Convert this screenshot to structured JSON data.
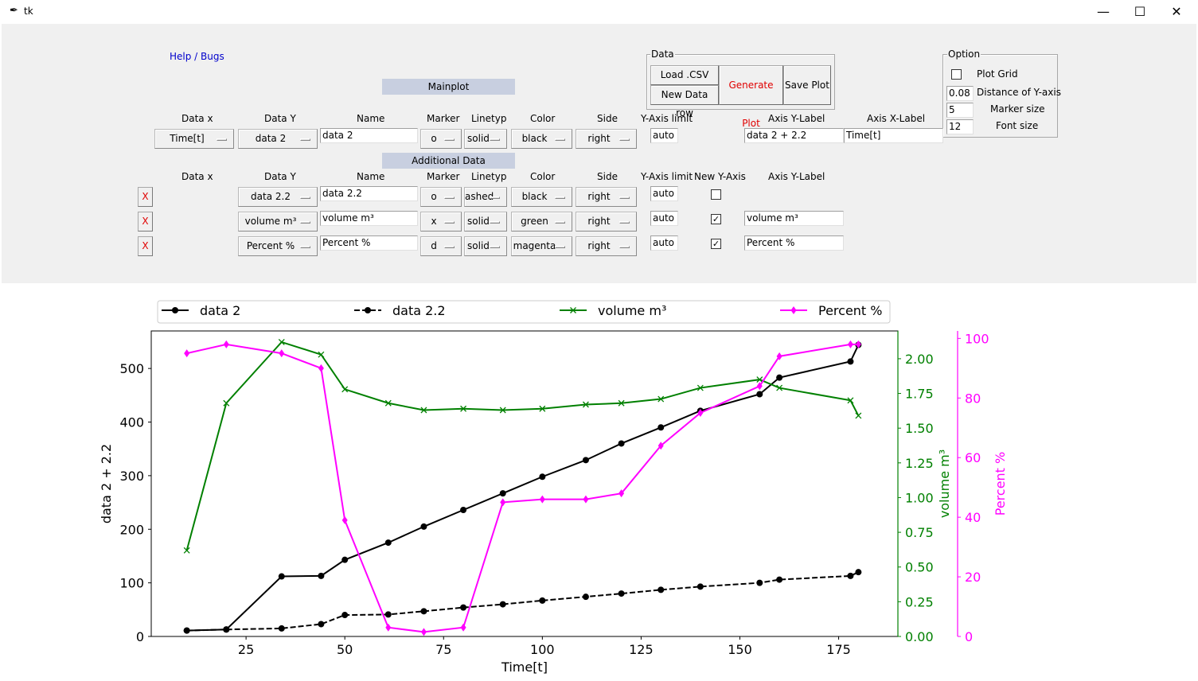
{
  "window": {
    "title": "tk",
    "minimize": "—",
    "maximize": "☐",
    "close": "✕"
  },
  "help_link": "Help / Bugs",
  "sections": {
    "main": "Mainplot",
    "additional": "Additional Data"
  },
  "data_frame": {
    "label": "Data",
    "load": "Load .CSV File",
    "new_row": "New Data row",
    "generate": "Generate Plot",
    "save": "Save Plot"
  },
  "option_frame": {
    "label": "Option",
    "plot_grid": "Plot Grid",
    "plot_grid_checked": false,
    "dist_label": "Distance of Y-axis",
    "dist_value": "0.08",
    "marker_label": "Marker size",
    "marker_value": "5",
    "font_label": "Font size",
    "font_value": "12"
  },
  "headers": {
    "data_x": "Data x",
    "data_y": "Data Y",
    "name": "Name",
    "marker": "Marker",
    "linetyp": "Linetyp",
    "color": "Color",
    "side": "Side",
    "ylimit": "Y-Axis limit",
    "new_yaxis": "New Y-Axis",
    "ylabel": "Axis Y-Label",
    "xlabel": "Axis X-Label"
  },
  "main_row": {
    "data_x": "Time[t]",
    "data_y": "data 2",
    "name": "data 2",
    "marker": "o",
    "linetyp": "solid",
    "color": "black",
    "side": "right",
    "ylimit": "auto",
    "ylabel": "data 2 + 2.2",
    "xlabel": "Time[t]"
  },
  "extra_rows": [
    {
      "x": "X",
      "data_y": "data 2.2",
      "name": "data 2.2",
      "marker": "o",
      "linetyp": "ashed",
      "color": "black",
      "side": "right",
      "ylimit": "auto",
      "new_axis": false,
      "ylabel": ""
    },
    {
      "x": "X",
      "data_y": "volume m³",
      "name": "volume m³",
      "marker": "x",
      "linetyp": "solid",
      "color": "green",
      "side": "right",
      "ylimit": "auto",
      "new_axis": true,
      "ylabel": "volume m³"
    },
    {
      "x": "X",
      "data_y": "Percent %",
      "name": "Percent %",
      "marker": "d",
      "linetyp": "solid",
      "color": "magenta",
      "side": "right",
      "ylimit": "auto",
      "new_axis": true,
      "ylabel": "Percent %"
    }
  ],
  "chart_data": {
    "type": "line",
    "xlabel": "Time[t]",
    "x": [
      10,
      20,
      34,
      44,
      50,
      61,
      70,
      80,
      90,
      100,
      111,
      120,
      130,
      140,
      155,
      160,
      178,
      180
    ],
    "xlim": [
      1,
      190
    ],
    "xticks": [
      25,
      50,
      75,
      100,
      125,
      150,
      175
    ],
    "legend": "top",
    "grid": false,
    "series": [
      {
        "name": "data 2",
        "axis": "left",
        "color": "#000000",
        "marker": "o",
        "dash": "solid",
        "values": [
          11,
          13,
          112,
          113,
          143,
          175,
          205,
          236,
          267,
          298,
          329,
          360,
          390,
          421,
          452,
          483,
          513,
          544
        ]
      },
      {
        "name": "data 2.2",
        "axis": "left",
        "color": "#000000",
        "marker": "o",
        "dash": "dashed",
        "values": [
          11,
          13,
          15,
          23,
          40,
          41,
          47,
          54,
          60,
          67,
          74,
          80,
          87,
          93,
          100,
          106,
          113,
          120
        ]
      },
      {
        "name": "volume m³",
        "axis": "volume",
        "color": "#008000",
        "marker": "x",
        "dash": "solid",
        "values": [
          0.62,
          1.68,
          2.12,
          2.03,
          1.78,
          1.68,
          1.63,
          1.64,
          1.63,
          1.64,
          1.67,
          1.68,
          1.71,
          1.79,
          1.85,
          1.79,
          1.7,
          1.59
        ]
      },
      {
        "name": "Percent %",
        "axis": "percent",
        "color": "#ff00ff",
        "marker": "d",
        "dash": "solid",
        "values": [
          95,
          98,
          95,
          90,
          39,
          3,
          1.5,
          3,
          45,
          46,
          46,
          48,
          64,
          75,
          84,
          94,
          98,
          98
        ]
      }
    ],
    "axes": {
      "left": {
        "label": "data 2 + 2.2",
        "ylim": [
          0,
          570
        ],
        "ticks": [
          0,
          100,
          200,
          300,
          400,
          500
        ],
        "color": "#000000"
      },
      "volume": {
        "label": "volume m³",
        "ylim": [
          0,
          2.2
        ],
        "ticks": [
          0.0,
          0.25,
          0.5,
          0.75,
          1.0,
          1.25,
          1.5,
          1.75,
          2.0
        ],
        "color": "#008000"
      },
      "percent": {
        "label": "Percent %",
        "ylim": [
          0,
          102.5
        ],
        "ticks": [
          0,
          20,
          40,
          60,
          80,
          100
        ],
        "color": "#ff00ff"
      }
    }
  }
}
